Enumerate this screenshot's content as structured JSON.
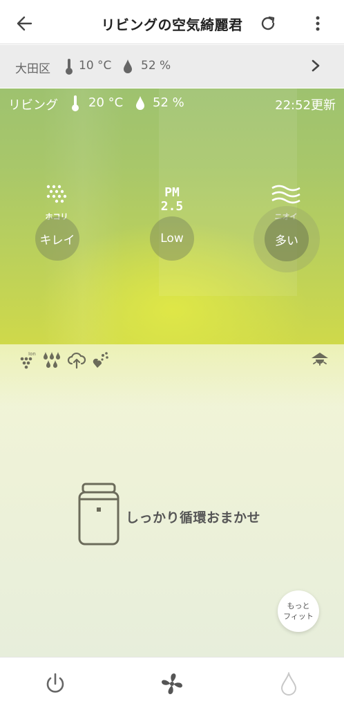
{
  "header": {
    "title": "リビングの空気綺麗君"
  },
  "outdoor": {
    "area": "大田区",
    "temperature": "10 °C",
    "humidity": "52 %"
  },
  "room": {
    "name": "リビング",
    "temperature": "20 °C",
    "humidity": "52 %",
    "updated": "22:52更新"
  },
  "sensors": [
    {
      "icon": "dust-icon",
      "label": "ホコリ",
      "value": "キレイ"
    },
    {
      "icon": "pm25-icon",
      "label": "",
      "value": "Low"
    },
    {
      "icon": "odor-icon",
      "label": "ニオイ",
      "value": "多い"
    }
  ],
  "mode_icons": [
    "ion-icon",
    "humidify-icon",
    "cloud-upload-icon",
    "heart-icon",
    "ceiling-light-icon"
  ],
  "mode": {
    "label": "しっかり循環おまかせ"
  },
  "fit_button": {
    "line1": "もっと",
    "line2": "フィット"
  },
  "nav": [
    "power-icon",
    "fan-icon",
    "water-drop-icon"
  ],
  "colors": {
    "hero_top": "#9ec26f",
    "hero_bottom": "#cfd94a",
    "text_gray": "#666666"
  }
}
